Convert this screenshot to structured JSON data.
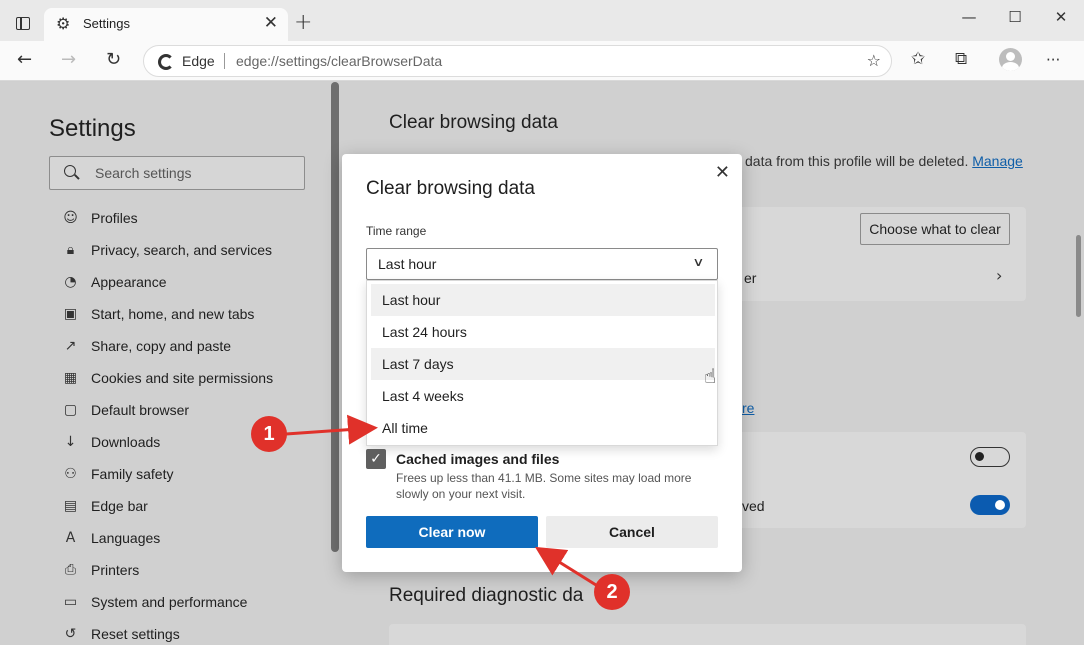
{
  "window": {
    "tab_title": "Settings",
    "tab_close": "✕",
    "new_tab": "+",
    "minimize": "—",
    "maximize": "☐",
    "close": "✕"
  },
  "toolbar": {
    "back": "←",
    "forward": "→",
    "refresh": "↻",
    "address_brand": "Edge",
    "address_url": "edge://settings/clearBrowserData",
    "favorite_star": "☆",
    "favorites": "✩",
    "collections": "⧉",
    "more": "···"
  },
  "sidebar": {
    "title": "Settings",
    "search_placeholder": "Search settings",
    "items": [
      {
        "label": "Profiles",
        "icon": "profile-icon",
        "glyph": "☺"
      },
      {
        "label": "Privacy, search, and services",
        "icon": "lock-icon",
        "glyph": "🔒︎"
      },
      {
        "label": "Appearance",
        "icon": "palette-icon",
        "glyph": "◔"
      },
      {
        "label": "Start, home, and new tabs",
        "icon": "home-tabs-icon",
        "glyph": "▣"
      },
      {
        "label": "Share, copy and paste",
        "icon": "share-icon",
        "glyph": "↗"
      },
      {
        "label": "Cookies and site permissions",
        "icon": "cookie-permissions-icon",
        "glyph": "▦"
      },
      {
        "label": "Default browser",
        "icon": "browser-icon",
        "glyph": "▢"
      },
      {
        "label": "Downloads",
        "icon": "download-icon",
        "glyph": "↓"
      },
      {
        "label": "Family safety",
        "icon": "family-icon",
        "glyph": "⚇"
      },
      {
        "label": "Edge bar",
        "icon": "edge-bar-icon",
        "glyph": "▤"
      },
      {
        "label": "Languages",
        "icon": "language-icon",
        "glyph": "A"
      },
      {
        "label": "Printers",
        "icon": "printer-icon",
        "glyph": "⎙"
      },
      {
        "label": "System and performance",
        "icon": "laptop-icon",
        "glyph": "▭"
      },
      {
        "label": "Reset settings",
        "icon": "reset-icon",
        "glyph": "↺"
      }
    ]
  },
  "main": {
    "title": "Clear browsing data",
    "desc_text": "data from this profile will be deleted. ",
    "desc_link": "Manage",
    "choose_button": "Choose what to clear",
    "frag_er": "er",
    "frag_re": "re",
    "frag_ved": "ved",
    "chevron": "›",
    "section_title": "Required diagnostic da"
  },
  "dialog": {
    "title": "Clear browsing data",
    "close": "✕",
    "time_range_label": "Time range",
    "selected": "Last hour",
    "options": [
      "Last hour",
      "Last 24 hours",
      "Last 7 days",
      "Last 4 weeks",
      "All time"
    ],
    "checkbox_title": "Cached images and files",
    "checkbox_desc": "Frees up less than 41.1 MB. Some sites may load more slowly on your next visit.",
    "clear_button": "Clear now",
    "cancel_button": "Cancel"
  },
  "annotations": {
    "badge_1": "1",
    "badge_2": "2",
    "color": "#e0312a"
  }
}
